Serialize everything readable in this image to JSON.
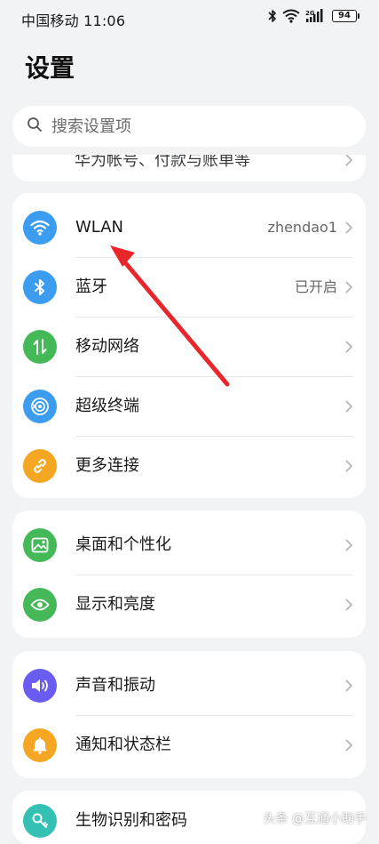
{
  "status_bar": {
    "carrier_time": "中国移动 11:06",
    "battery_level": "94",
    "network_label": "2G"
  },
  "page": {
    "title": "设置"
  },
  "search": {
    "placeholder": "搜索设置项"
  },
  "partial_item": {
    "label": "华为帐号、付款与账单等"
  },
  "connectivity": {
    "items": [
      {
        "label": "WLAN",
        "value": "zhendao1",
        "icon": "wifi-icon",
        "color": "#3b9cf0"
      },
      {
        "label": "蓝牙",
        "value": "已开启",
        "icon": "bluetooth-icon",
        "color": "#3b9cf0"
      },
      {
        "label": "移动网络",
        "value": "",
        "icon": "mobile-network-icon",
        "color": "#45b958"
      },
      {
        "label": "超级终端",
        "value": "",
        "icon": "super-device-icon",
        "color": "#3b9cf0"
      },
      {
        "label": "更多连接",
        "value": "",
        "icon": "link-icon",
        "color": "#f5a623"
      }
    ]
  },
  "display": {
    "items": [
      {
        "label": "桌面和个性化",
        "icon": "wallpaper-icon",
        "color": "#45b958"
      },
      {
        "label": "显示和亮度",
        "icon": "eye-icon",
        "color": "#45b958"
      }
    ]
  },
  "sound": {
    "items": [
      {
        "label": "声音和振动",
        "icon": "speaker-icon",
        "color": "#6a5cf0"
      },
      {
        "label": "通知和状态栏",
        "icon": "bell-icon",
        "color": "#f5a623"
      }
    ]
  },
  "security": {
    "items": [
      {
        "label": "生物识别和密码",
        "icon": "key-icon",
        "color": "#34c0b3"
      }
    ]
  },
  "watermark": "头条 @互通小助手"
}
